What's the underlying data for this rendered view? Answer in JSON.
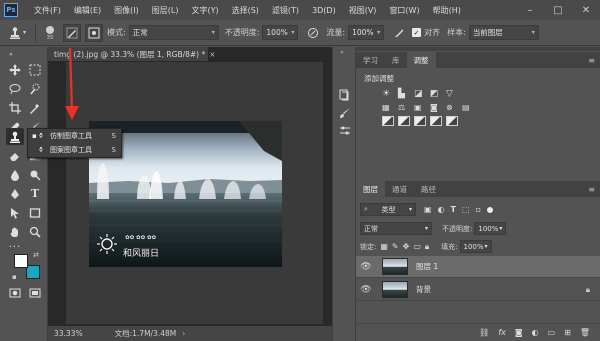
{
  "app": {
    "logo": "Ps"
  },
  "menu": [
    "文件(F)",
    "编辑(E)",
    "图像(I)",
    "图层(L)",
    "文字(Y)",
    "选择(S)",
    "滤镜(T)",
    "3D(D)",
    "视图(V)",
    "窗口(W)",
    "帮助(H)"
  ],
  "window_controls": {
    "minimize": "–",
    "maximize": "□",
    "close": "✕"
  },
  "options": {
    "brush_size": "35",
    "mode_label": "模式:",
    "mode_value": "正常",
    "opacity_label": "不透明度:",
    "opacity_value": "100%",
    "flow_label": "流量:",
    "flow_value": "100%",
    "align_label": "对齐",
    "sample_label": "样本:",
    "sample_value": "当前图层"
  },
  "document": {
    "tab_title": "timg (2).jpg @ 33.3% (图层 1, RGB/8#) *",
    "tab_close": "×",
    "zoom": "33.33%",
    "doc_info": "文档:1.7M/3.48M",
    "watermark_line1": "✿✿ ✿✿ ✿✿",
    "watermark_line2": "和风丽日"
  },
  "flyout": {
    "items": [
      {
        "label": "仿制图章工具",
        "shortcut": "S",
        "selected": true
      },
      {
        "label": "图案图章工具",
        "shortcut": "S",
        "selected": false
      }
    ]
  },
  "panels": {
    "top_tabs": [
      "学习",
      "库",
      "调整"
    ],
    "active_top_tab": "调整",
    "adjust_title": "添加调整",
    "layer_tabs": [
      "图层",
      "通道",
      "路径"
    ],
    "active_layer_tab": "图层",
    "kind_label": "类型",
    "blend_mode": "正常",
    "opacity_label": "不透明度:",
    "opacity_value": "100%",
    "lock_label": "锁定:",
    "fill_label": "填充:",
    "fill_value": "100%",
    "layers": [
      {
        "name": "图层 1",
        "selected": true,
        "locked": false
      },
      {
        "name": "背景",
        "selected": false,
        "locked": true
      }
    ],
    "bottom_icons": [
      "link-icon",
      "fx-icon",
      "mask-icon",
      "adjustment-icon",
      "group-icon",
      "new-layer-icon",
      "trash-icon"
    ]
  },
  "colors": {
    "foreground": "#ffffff",
    "background": "#1aa6c8",
    "annotation_arrow": "#e8312a"
  }
}
